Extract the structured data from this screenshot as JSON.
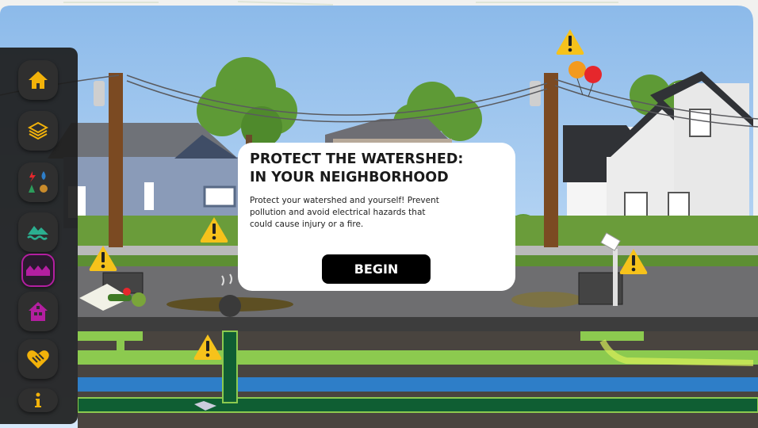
{
  "dialog": {
    "title_line1": "PROTECT THE WATERSHED:",
    "title_line2": "IN YOUR NEIGHBORHOOD",
    "body": "Protect your watershed and yourself! Prevent pollution and avoid electrical hazards that could cause injury or a fire.",
    "begin_label": "BEGIN"
  },
  "sidebar": {
    "items": [
      {
        "name": "home",
        "icon": "home-icon"
      },
      {
        "name": "layers",
        "icon": "layers-icon"
      },
      {
        "name": "hazards",
        "icon": "hazard-types-icon"
      },
      {
        "name": "watershed",
        "icon": "mountain-water-icon"
      },
      {
        "name": "neighborhood",
        "icon": "neighborhood-houses-icon",
        "active": true
      },
      {
        "name": "home-inside",
        "icon": "house-outline-icon"
      },
      {
        "name": "community",
        "icon": "heart-hands-icon"
      },
      {
        "name": "info",
        "icon": "info-icon"
      }
    ]
  },
  "colors": {
    "sky": "#9fc7ef",
    "grass": "#6a9c3a",
    "road": "#6e6e70",
    "nav_accent": "#f2b20a",
    "active_accent": "#b31fa0",
    "warning": "#f6c21b",
    "pipe_green": "#8cca4f",
    "pipe_blue": "#2e7ec8"
  }
}
